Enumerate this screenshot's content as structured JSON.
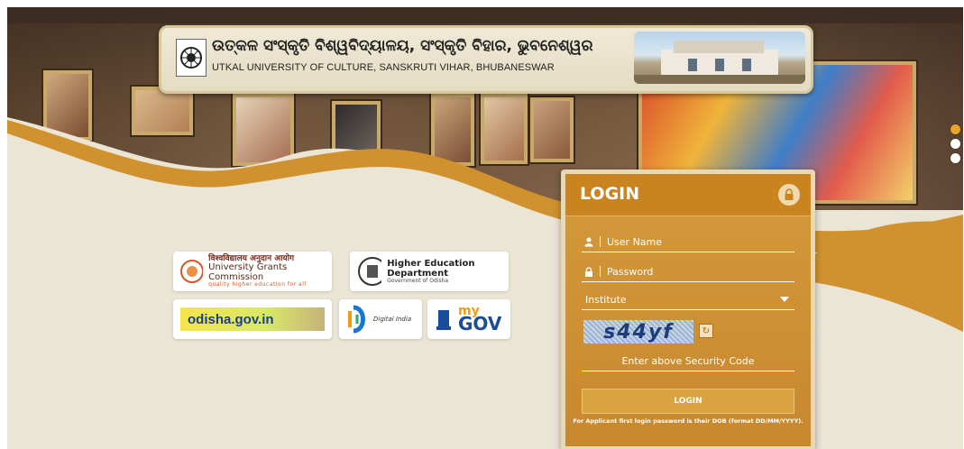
{
  "header": {
    "title_odia": "ଉତ୍କଳ ସଂସ୍କୃତି ବିଶ୍ୱବିଦ୍ୟାଳୟ, ସଂସ୍କୃତି ବିହାର, ଭୁବନେଶ୍ୱର",
    "title_english": "UTKAL UNIVERSITY OF CULTURE, SANSKRUTI VIHAR, BHUBANESWAR"
  },
  "partners": {
    "ugc": {
      "hindi": "विश्वविद्यालय अनुदान आयोग",
      "name": "University Grants Commission",
      "tagline": "quality higher education for all"
    },
    "hed": {
      "name": "Higher Education Department",
      "sub": "Government of Odisha"
    },
    "odisha": {
      "name": "odisha.gov.in"
    },
    "digital_india": {
      "name": "Digital India"
    },
    "mygov": {
      "my": "my",
      "gov": "GOV"
    }
  },
  "login": {
    "title": "LOGIN",
    "username_placeholder": "User Name",
    "password_placeholder": "Password",
    "institute_selected": "Institute",
    "captcha_text": "s44yf",
    "captcha_placeholder": "Enter above Security Code",
    "button_label": "LOGIN",
    "note": "For Applicant first login password is their DOB (format DD/MM/YYYY)."
  },
  "slider": {
    "total": 3,
    "active_index": 0
  },
  "colors": {
    "accent": "#c98420",
    "panel": "#d49a3a",
    "background": "#ebe5d6",
    "active_dot": "#e9a52b"
  }
}
